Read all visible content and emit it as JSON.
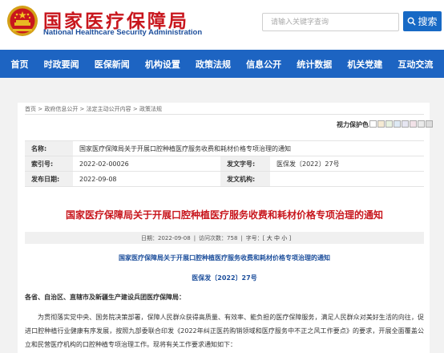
{
  "header": {
    "site_title": "国家医疗保障局",
    "site_subtitle": "National Healthcare Security Administration",
    "emblem_icon": "national-emblem-icon",
    "search_placeholder": "请输入关键字查询",
    "search_button_label": "搜索",
    "search_icon": "search-icon"
  },
  "nav": {
    "items": [
      {
        "label": "首页"
      },
      {
        "label": "时政要闻"
      },
      {
        "label": "医保新闻"
      },
      {
        "label": "机构设置"
      },
      {
        "label": "政策法规"
      },
      {
        "label": "信息公开"
      },
      {
        "label": "统计数据"
      },
      {
        "label": "机关党建"
      },
      {
        "label": "互动交流"
      }
    ]
  },
  "breadcrumb": "首页 > 政府信息公开 > 法定主动公开内容 > 政策法规",
  "vision": {
    "label": "视力保护色：",
    "swatches": [
      "#ffffff",
      "#f5ead3",
      "#e8f2e0",
      "#dde9f4",
      "#e6e6f2",
      "#f2e2e8",
      "#eaeaea",
      "#dddddd"
    ]
  },
  "info": {
    "name_label": "名称:",
    "name_value": "国家医疗保障局关于开展口腔种植医疗服务收费和耗材价格专项治理的通知",
    "index_label": "索引号:",
    "index_value": "2022-02-00026",
    "doc_no_label": "发文字号:",
    "doc_no_value": "医保发〔2022〕27号",
    "date_label": "发布日期:",
    "date_value": "2022-09-08",
    "org_label": "发文机构:",
    "org_value": ""
  },
  "article": {
    "title": "国家医疗保障局关于开展口腔种植医疗服务收费和耗材价格专项治理的通知",
    "meta_date": "日期：2022-09-08",
    "meta_sep": "|",
    "meta_views": "访问次数：758",
    "meta_font_label": "字号：[",
    "meta_font_large": "大",
    "meta_font_medium": "中",
    "meta_font_small": "小",
    "meta_font_close": "]",
    "subtitle": "国家医疗保障局关于开展口腔种植医疗服务收费和耗材价格专项治理的通知",
    "doc_number": "医保发〔2022〕27号",
    "addressee": "各省、自治区、直辖市及新疆生产建设兵团医疗保障局：",
    "body": "为贯彻落实党中央、国务院决策部署，保障人民群众获得高质量、有效率、能负担的医疗保障服务，满足人民群众对美好生活的向往，促进口腔种植行业健康有序发展，按照九部委联合印发《2022年纠正医药购销领域和医疗服务中不正之风工作要点》的要求，开展全面覆盖公立和民营医疗机构的口腔种植专项治理工作。现将有关工作要求通知如下："
  }
}
